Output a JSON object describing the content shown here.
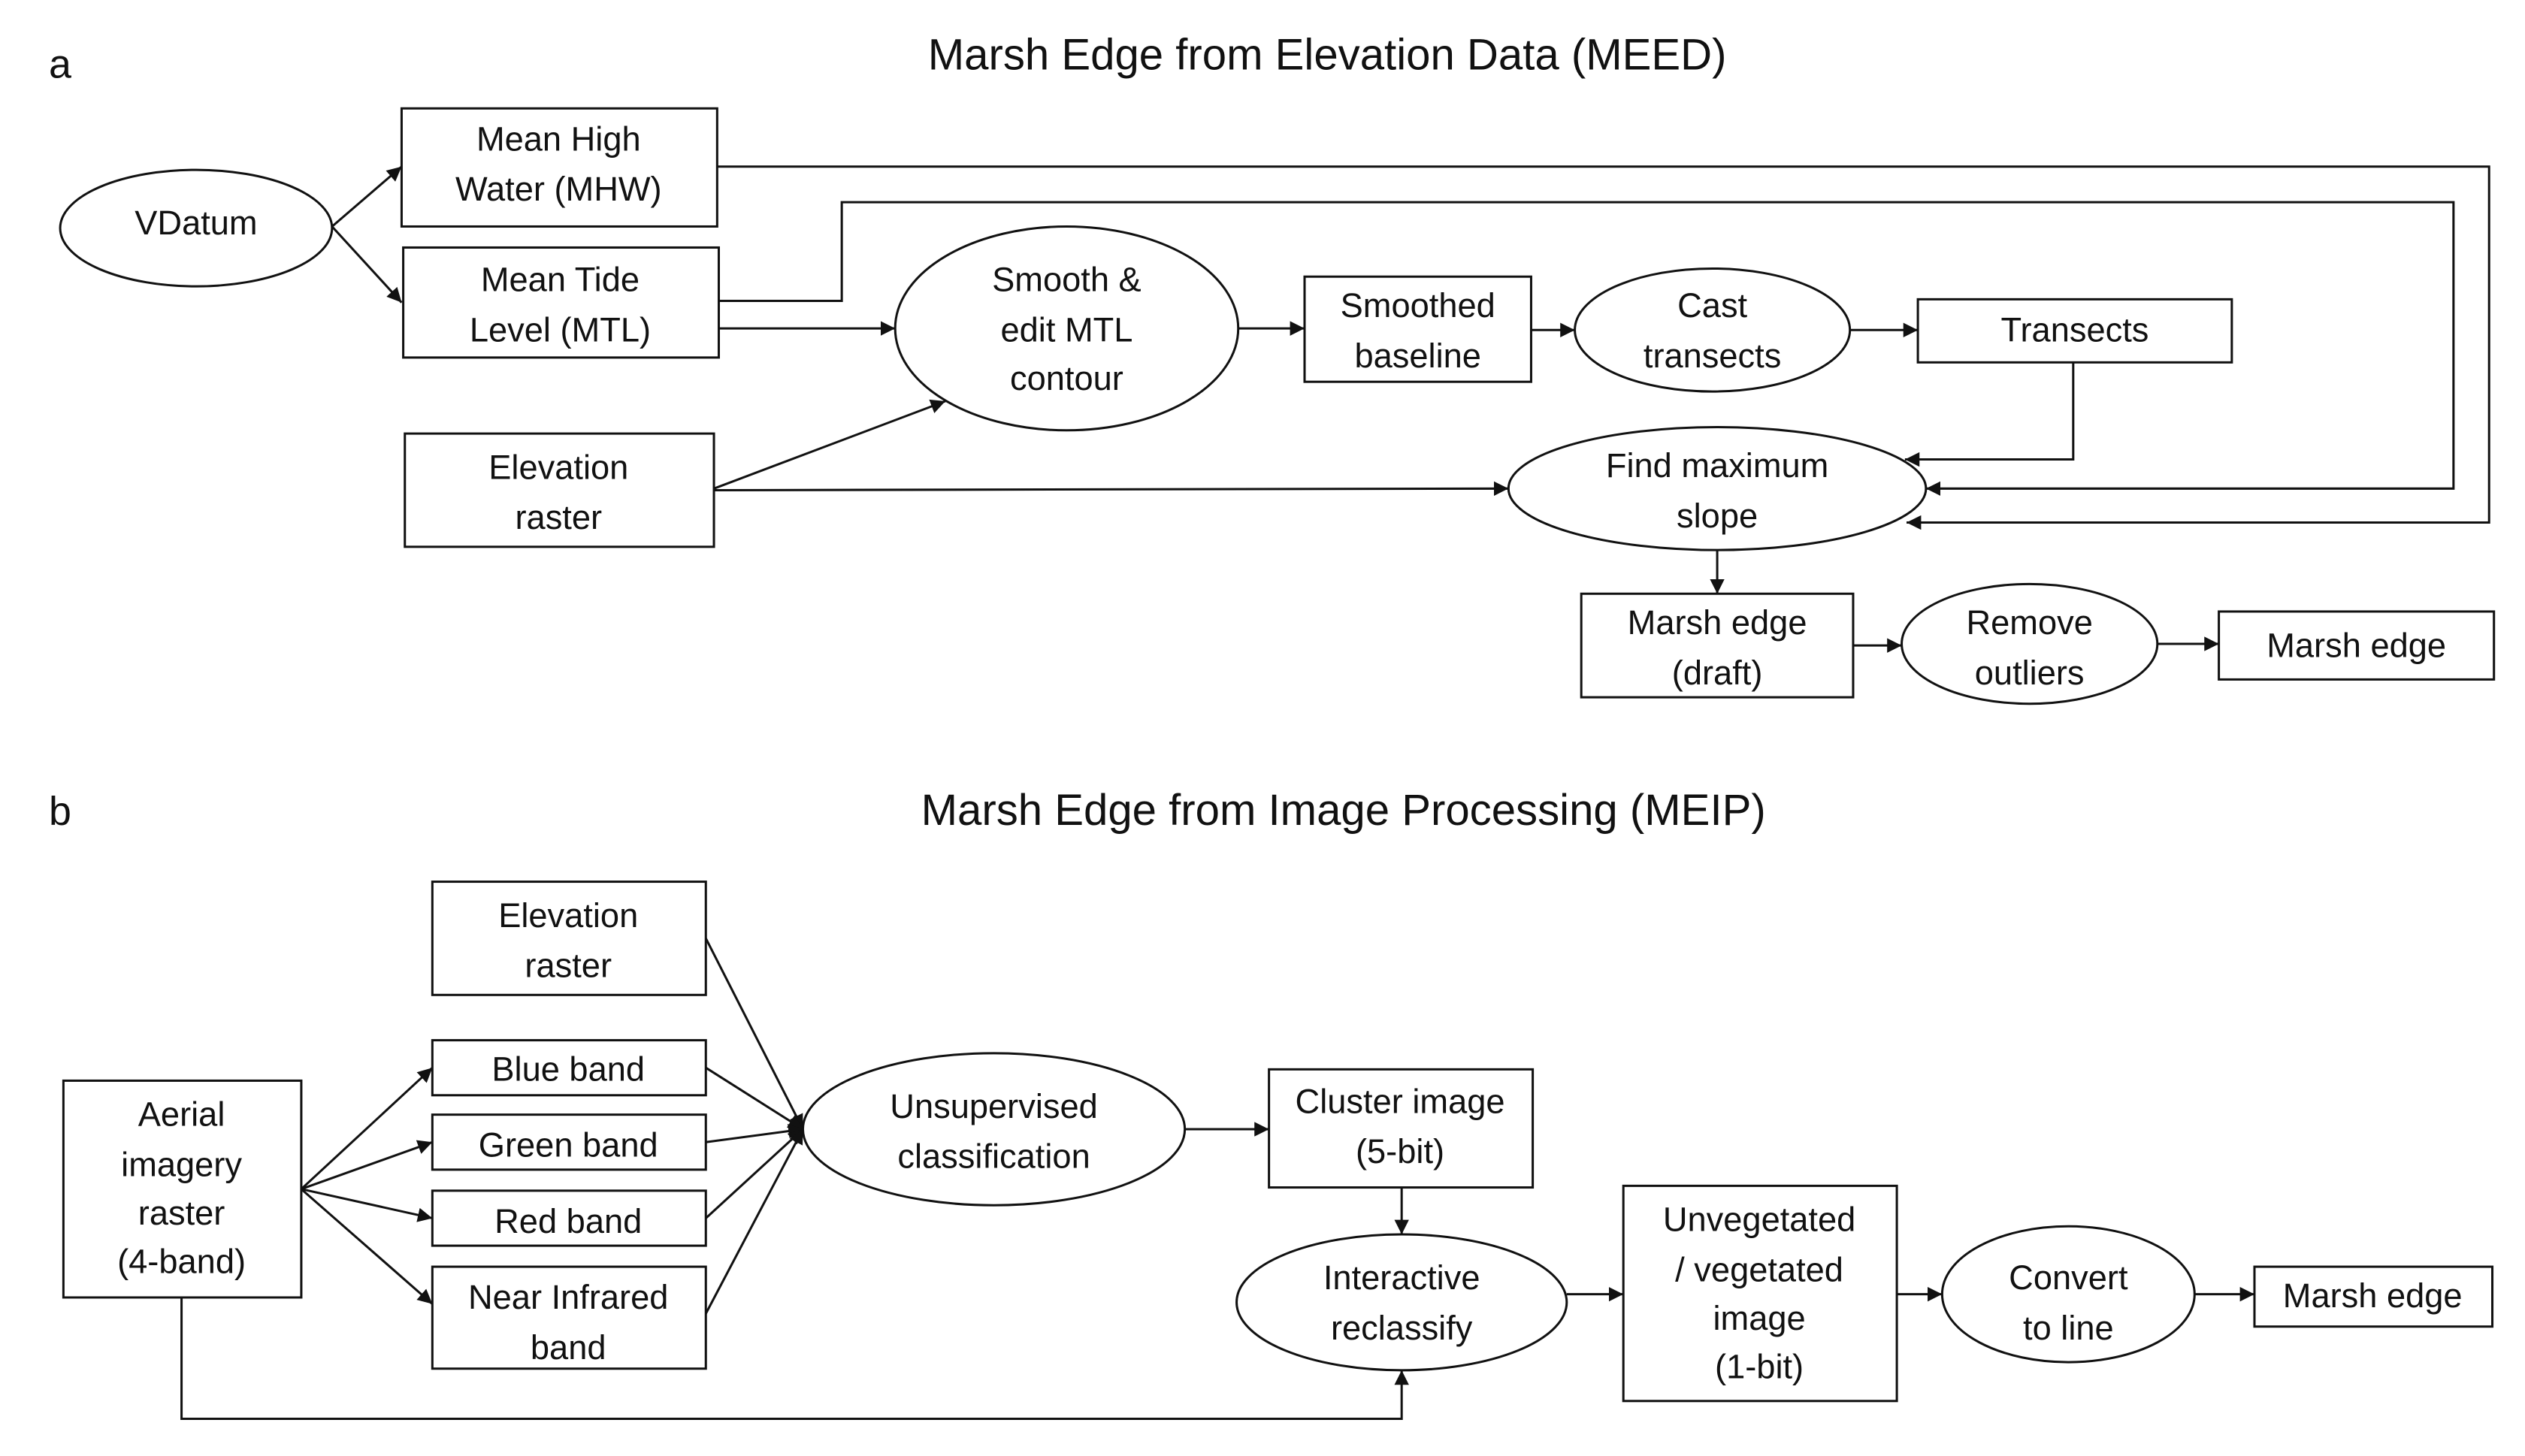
{
  "panel_a": {
    "label": "a",
    "title": "Marsh Edge from Elevation Data (MEED)",
    "nodes": {
      "vdatum": [
        "VDatum"
      ],
      "mhw": [
        "Mean  High",
        "Water (MHW)"
      ],
      "mtl": [
        "Mean  Tide",
        "Level (MTL)"
      ],
      "elevation": [
        "Elevation",
        "raster"
      ],
      "smooth": [
        "Smooth &",
        "edit MTL",
        "contour"
      ],
      "baseline": [
        "Smoothed",
        "baseline"
      ],
      "cast": [
        "Cast",
        "transects"
      ],
      "transects": [
        "Transects"
      ],
      "maxslope": [
        "Find maximum",
        "slope"
      ],
      "draft": [
        "Marsh edge",
        "(draft)"
      ],
      "outliers": [
        "Remove",
        "outliers"
      ],
      "edge": [
        "Marsh edge"
      ]
    }
  },
  "panel_b": {
    "label": "b",
    "title": "Marsh Edge from Image Processing (MEIP)",
    "nodes": {
      "elevation": [
        "Elevation",
        "raster"
      ],
      "blue": [
        "Blue band"
      ],
      "green": [
        "Green band"
      ],
      "red": [
        "Red band"
      ],
      "nir": [
        "Near Infrared",
        "band"
      ],
      "aerial": [
        "Aerial",
        "imagery",
        "raster",
        "(4-band)"
      ],
      "unsup": [
        "Unsupervised",
        "classification"
      ],
      "cluster": [
        "Cluster image",
        "(5-bit)"
      ],
      "reclass": [
        "Interactive",
        "reclassify"
      ],
      "unveg": [
        "Unvegetated",
        "/ vegetated",
        "image",
        "(1-bit)"
      ],
      "convert": [
        "Convert",
        "to line"
      ],
      "edge": [
        "Marsh edge"
      ]
    }
  }
}
